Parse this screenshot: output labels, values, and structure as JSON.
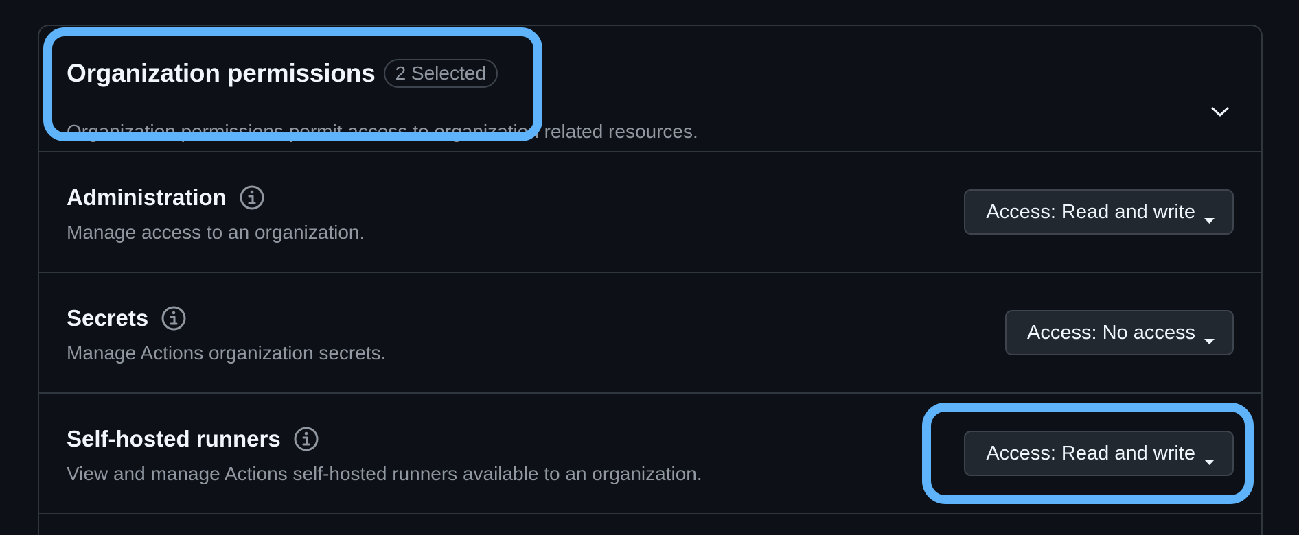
{
  "organization_permissions": {
    "title": "Organization permissions",
    "selected_badge": "2 Selected",
    "description": "Organization permissions permit access to organization related resources.",
    "toggle_icon": "chevron-down-icon"
  },
  "permissions": [
    {
      "title": "Administration",
      "description": "Manage access to an organization.",
      "access_label": "Access: Read and write",
      "info_icon": "info-icon",
      "dropdown_icon": "caret-down-icon"
    },
    {
      "title": "Secrets",
      "description": "Manage Actions organization secrets.",
      "access_label": "Access: No access",
      "info_icon": "info-icon",
      "dropdown_icon": "caret-down-icon"
    },
    {
      "title": "Self-hosted runners",
      "description": "View and manage Actions self-hosted runners available to an organization.",
      "access_label": "Access: Read and write",
      "info_icon": "info-icon",
      "dropdown_icon": "caret-down-icon"
    }
  ],
  "colors": {
    "background": "#0d1117",
    "border": "#30363d",
    "primary_text": "#f0f6fc",
    "secondary_text": "#9198a1",
    "button_background": "#212830",
    "highlight": "#5fb3fa"
  }
}
